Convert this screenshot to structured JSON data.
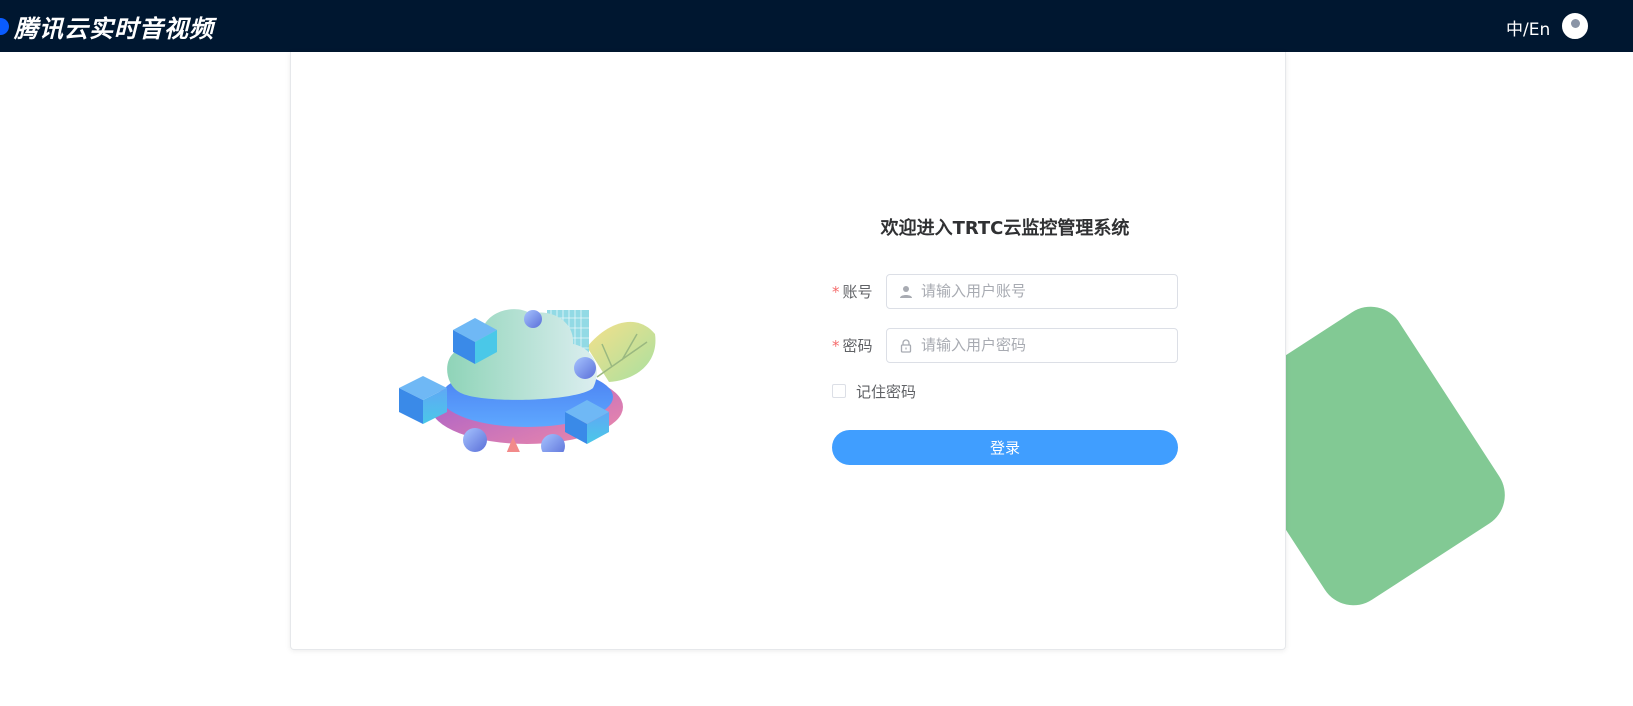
{
  "header": {
    "brand": "腾讯云实时音视频",
    "lang_switch": "中/En"
  },
  "login": {
    "title": "欢迎进入TRTC云监控管理系统",
    "account_label": "账号",
    "account_placeholder": "请输入用户账号",
    "password_label": "密码",
    "password_placeholder": "请输入用户密码",
    "required_mark": "*",
    "remember_label": "记住密码",
    "remember_checked": false,
    "submit_label": "登录"
  },
  "colors": {
    "header_bg": "#001730",
    "primary": "#409eff",
    "accent_green": "#82c994",
    "required": "#f56c6c"
  },
  "icons": {
    "brand": "tencent-cloud-logo-icon",
    "account": "user-icon",
    "password": "lock-icon"
  }
}
